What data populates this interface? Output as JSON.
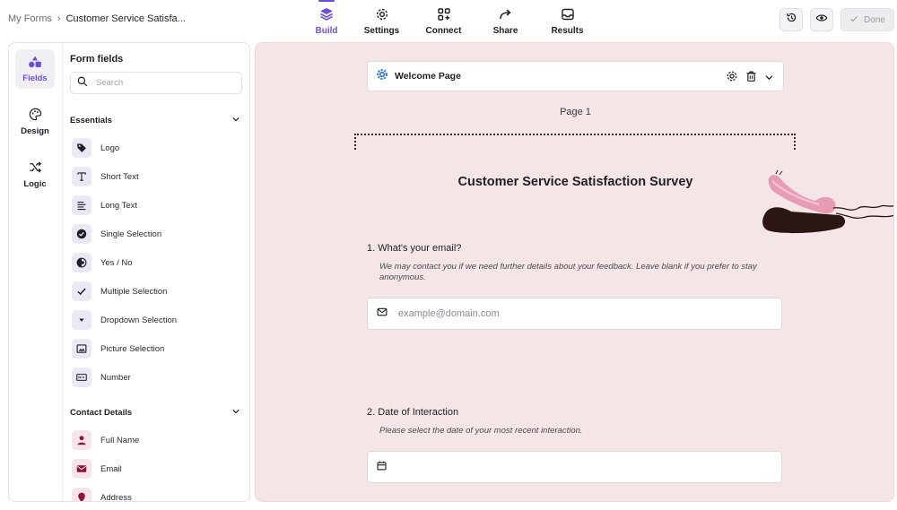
{
  "breadcrumb": {
    "parent": "My Forms",
    "current": "Customer Service Satisfa..."
  },
  "nav": {
    "tabs": [
      {
        "label": "Build",
        "icon": "layers-icon",
        "active": true
      },
      {
        "label": "Settings",
        "icon": "gear-icon"
      },
      {
        "label": "Connect",
        "icon": "apps-plus-icon"
      },
      {
        "label": "Share",
        "icon": "share-arrow-icon"
      },
      {
        "label": "Results",
        "icon": "inbox-icon"
      }
    ],
    "done_label": "Done"
  },
  "rail": {
    "items": [
      {
        "label": "Fields",
        "icon": "shapes-icon",
        "active": true
      },
      {
        "label": "Design",
        "icon": "palette-icon"
      },
      {
        "label": "Logic",
        "icon": "shuffle-icon"
      }
    ]
  },
  "fields_panel": {
    "title": "Form fields",
    "search_placeholder": "Search",
    "essentials": {
      "heading": "Essentials",
      "items": [
        "Logo",
        "Short Text",
        "Long Text",
        "Single Selection",
        "Yes / No",
        "Multiple Selection",
        "Dropdown Selection",
        "Picture Selection",
        "Number"
      ]
    },
    "contact": {
      "heading": "Contact Details",
      "items": [
        "Full Name",
        "Email",
        "Address"
      ]
    }
  },
  "canvas": {
    "page_bar_label": "Welcome Page",
    "page_number": "Page 1",
    "form_title": "Customer Service Satisfaction Survey",
    "questions": [
      {
        "label": "1.  What's your email?",
        "description": "We may contact you if we need further details about your feedback. Leave blank if you prefer to stay anonymous.",
        "placeholder": "example@domain.com"
      },
      {
        "label": "2.  Date of Interaction",
        "description": "Please select the date of your most recent interaction.",
        "placeholder": ""
      }
    ]
  },
  "colors": {
    "accent": "#6d4fd8",
    "canvas_bg": "#f4e6e6",
    "icon_bg": "#ebe8f6",
    "contact_icon": "#8a1538"
  }
}
